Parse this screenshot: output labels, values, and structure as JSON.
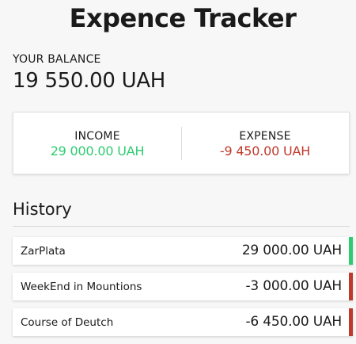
{
  "app": {
    "title": "Expence Tracker"
  },
  "balance": {
    "label": "YOUR BALANCE",
    "value": "19 550.00 UAH"
  },
  "summary": {
    "income_label": "INCOME",
    "income_value": "29 000.00 UAH",
    "expense_label": "EXPENSE",
    "expense_value": "-9 450.00 UAH"
  },
  "history": {
    "title": "History",
    "transactions": [
      {
        "name": "ZarPlata",
        "amount": "29 000.00 UAH",
        "type": "plus"
      },
      {
        "name": "WeekEnd in Mountions",
        "amount": "-3 000.00 UAH",
        "type": "minus"
      },
      {
        "name": "Course of Deutch",
        "amount": "-6 450.00 UAH",
        "type": "minus"
      }
    ]
  },
  "colors": {
    "income": "#2ecc71",
    "expense": "#c0392b",
    "background": "#f7f7f7"
  }
}
